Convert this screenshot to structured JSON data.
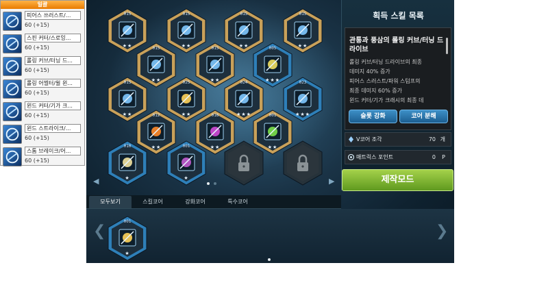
{
  "tooltip_list": {
    "title": "일괄",
    "items": [
      {
        "name": "피어스 쓰러스트/...",
        "level": "60 (+15)",
        "icon": "pierce-thrust-icon"
      },
      {
        "name": "스핀 커터/스로잉...",
        "level": "60 (+15)",
        "icon": "spin-cutter-icon"
      },
      {
        "name": "롤링 커브/터닝 드...",
        "level": "60 (+15)",
        "icon": "rolling-curve-icon"
      },
      {
        "name": "롤링 어썰터/윌 윈...",
        "level": "60 (+15)",
        "icon": "rolling-assaulter-icon"
      },
      {
        "name": "윈드 커터/기가 크...",
        "level": "60 (+15)",
        "icon": "wind-cutter-icon"
      },
      {
        "name": "윈드 스트라이크/...",
        "level": "60 (+15)",
        "icon": "wind-strike-icon"
      },
      {
        "name": "스톰 브레이크/어...",
        "level": "60 (+15)",
        "icon": "storm-break-icon"
      }
    ]
  },
  "core_grid": {
    "cores": [
      {
        "level": "015",
        "stars": "★★",
        "frame": "gold",
        "icon": "pierce-core"
      },
      {
        "level": "015",
        "stars": "★★",
        "frame": "gold",
        "icon": "spin-core"
      },
      {
        "level": "015",
        "stars": "★★",
        "frame": "gold",
        "icon": "wind-core"
      },
      {
        "level": "015",
        "stars": "★★",
        "frame": "gold",
        "icon": "rolling-core"
      },
      {
        "level": "015",
        "stars": "★★",
        "frame": "gold",
        "icon": "assault-core"
      },
      {
        "level": "015",
        "stars": "★★",
        "frame": "gold",
        "icon": "curve-core"
      },
      {
        "level": "005",
        "stars": "★★★",
        "frame": "blue",
        "icon": "bubbles-core"
      },
      {
        "level": "015",
        "stars": "★★",
        "frame": "gold",
        "icon": "cutter-core"
      },
      {
        "level": "025",
        "stars": "★★",
        "frame": "gold",
        "icon": "angel-core"
      },
      {
        "level": "024",
        "stars": "★★★",
        "frame": "gold",
        "icon": "ice-core"
      },
      {
        "level": "023",
        "stars": "★★★",
        "frame": "blue",
        "icon": "shard-core"
      },
      {
        "level": "012",
        "stars": "★★",
        "frame": "gold",
        "icon": "fire-core"
      },
      {
        "level": "016",
        "stars": "★★",
        "frame": "gold",
        "icon": "purple-core"
      },
      {
        "level": "001",
        "stars": "★★",
        "frame": "gold",
        "icon": "green-core"
      },
      {
        "level": "010",
        "stars": "★",
        "frame": "blue",
        "icon": "figure-core"
      },
      {
        "level": "001",
        "stars": "★",
        "frame": "blue",
        "icon": "rune-core"
      },
      {
        "level": "",
        "stars": "",
        "frame": "locked",
        "icon": "lock-icon"
      },
      {
        "level": "",
        "stars": "",
        "frame": "locked",
        "icon": "lock-icon"
      }
    ]
  },
  "panel": {
    "title": "획득 스킬 목록",
    "skill_title": "관통과 풍삼의 롤링 커브/터닝 드라이브",
    "desc_lines": [
      "롤링 커브/터닝 드라이브의 최종",
      "데미지 40% 증가",
      "피어스 스러스트/파워 스텀프의",
      "최종 데미지 60% 증가",
      "윈드 커터/기가 크래시의 최종 데"
    ],
    "enhance_button": "슬롯 강화",
    "disassemble_button": "코어 분해",
    "v_core_label": "V코어 조각",
    "v_core_value": "70",
    "v_core_unit": "개",
    "matrix_label": "매트릭스 포인트",
    "matrix_value": "0",
    "matrix_unit": "P",
    "craft_button": "제작모드"
  },
  "tabs": [
    {
      "label": "모두보기",
      "active": true
    },
    {
      "label": "스킬코어",
      "active": false
    },
    {
      "label": "강화코어",
      "active": false
    },
    {
      "label": "특수코어",
      "active": false
    }
  ],
  "equip": {
    "level": "001",
    "stars": "★"
  },
  "colors": {
    "gold_frame": "#c9a15a",
    "blue_frame": "#2e7fb8",
    "craft_green": "#8cc43a"
  }
}
